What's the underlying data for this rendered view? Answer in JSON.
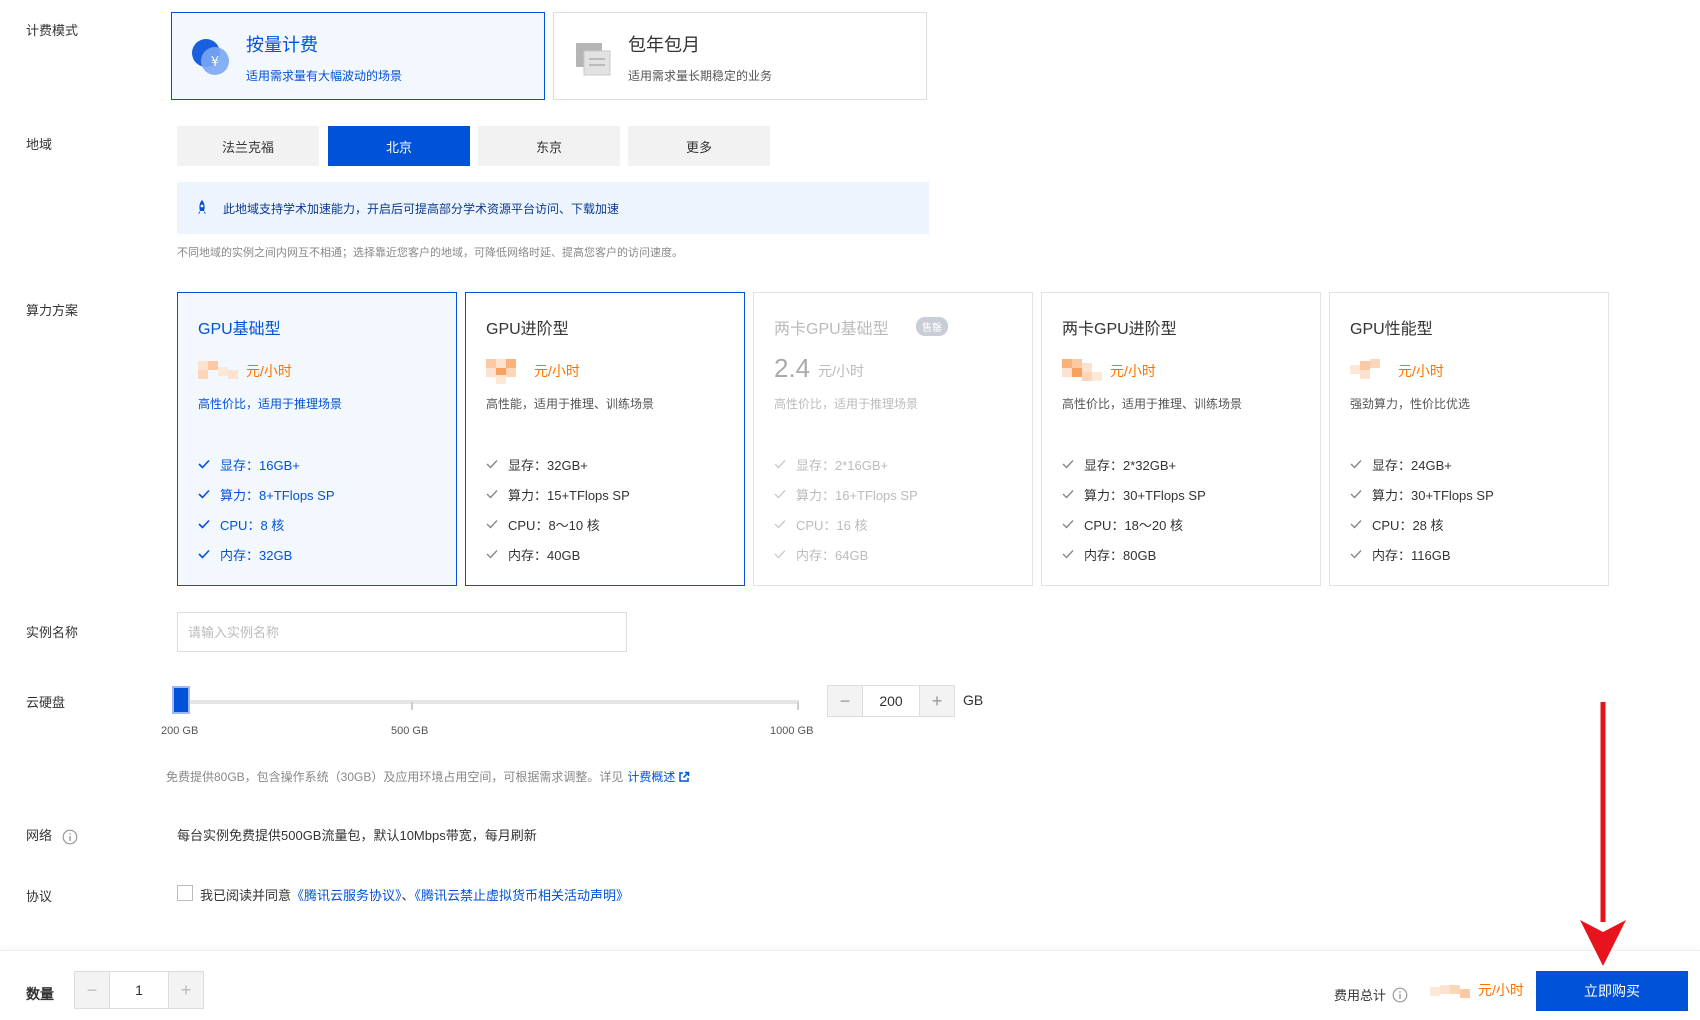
{
  "billing": {
    "label": "计费模式",
    "options": [
      {
        "title": "按量计费",
        "desc": "适用需求量有大幅波动的场景"
      },
      {
        "title": "包年包月",
        "desc": "适用需求量长期稳定的业务"
      }
    ]
  },
  "region": {
    "label": "地域",
    "options": [
      "法兰克福",
      "北京",
      "东京",
      "更多"
    ],
    "selected": "北京",
    "tip": "此地域支持学术加速能力，开启后可提高部分学术资源平台访问、下载加速",
    "note": "不同地域的实例之间内网互不相通；选择靠近您客户的地域，可降低网络时延、提高您客户的访问速度。"
  },
  "plans": {
    "label": "算力方案",
    "items": [
      {
        "title": "GPU基础型",
        "price": "",
        "unit": "元/小时",
        "desc": "高性价比，适用于推理场景",
        "specs": [
          "显存：16GB+",
          "算力：8+TFlops SP",
          "CPU：8 核",
          "内存：32GB"
        ]
      },
      {
        "title": "GPU进阶型",
        "price": "",
        "unit": "元/小时",
        "desc": "高性能，适用于推理、训练场景",
        "specs": [
          "显存：32GB+",
          "算力：15+TFlops SP",
          "CPU：8～10 核",
          "内存：40GB"
        ]
      },
      {
        "title": "两卡GPU基础型",
        "badge": "售罄",
        "price": "2.4",
        "unit": "元/小时",
        "desc": "高性价比，适用于推理场景",
        "specs": [
          "显存：2*16GB+",
          "算力：16+TFlops SP",
          "CPU：16 核",
          "内存：64GB"
        ]
      },
      {
        "title": "两卡GPU进阶型",
        "price": "",
        "unit": "元/小时",
        "desc": "高性价比，适用于推理、训练场景",
        "specs": [
          "显存：2*32GB+",
          "算力：30+TFlops SP",
          "CPU：18～20 核",
          "内存：80GB"
        ]
      },
      {
        "title": "GPU性能型",
        "price": "",
        "unit": "元/小时",
        "desc": "强劲算力，性价比优选",
        "specs": [
          "显存：24GB+",
          "算力：30+TFlops SP",
          "CPU：28 核",
          "内存：116GB"
        ]
      }
    ]
  },
  "instance_name": {
    "label": "实例名称",
    "placeholder": "请输入实例名称",
    "value": ""
  },
  "disk": {
    "label": "云硬盘",
    "slider_labels": [
      "200 GB",
      "500 GB",
      "1000 GB"
    ],
    "value": "200",
    "unit": "GB",
    "minus": "−",
    "plus": "+",
    "note": "免费提供80GB，包含操作系统（30GB）及应用环境占用空间，可根据需求调整。详见",
    "note_link": "计费概述"
  },
  "network": {
    "label": "网络",
    "text": "每台实例免费提供500GB流量包，默认10Mbps带宽，每月刷新"
  },
  "agreement": {
    "label": "协议",
    "prefix": "我已阅读并同意",
    "link1": "《腾讯云服务协议》",
    "sep": "、",
    "link2": "《腾讯云禁止虚拟货币相关活动声明》"
  },
  "footer": {
    "qty_label": "数量",
    "qty_value": "1",
    "minus": "−",
    "plus": "+",
    "total_label": "费用总计",
    "total_unit": "元/小时",
    "buy_label": "立即购买"
  },
  "colors": {
    "brand": "#0052d9",
    "price": "#ff7200",
    "annotation": "#e8141d"
  }
}
